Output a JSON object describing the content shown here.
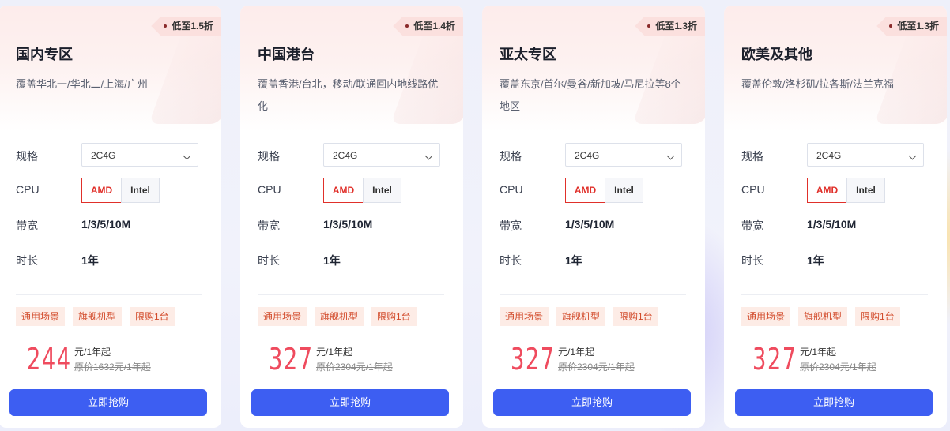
{
  "cards": [
    {
      "discount": "低至1.5折",
      "title": "国内专区",
      "description": "覆盖华北一/华北二/上海/广州",
      "spec_label": "规格",
      "spec_value": "2C4G",
      "cpu_label": "CPU",
      "cpu_options": [
        "AMD",
        "Intel"
      ],
      "cpu_selected": "AMD",
      "bandwidth_label": "带宽",
      "bandwidth_value": "1/3/5/10M",
      "duration_label": "时长",
      "duration_value": "1年",
      "tags": [
        "通用场景",
        "旗舰机型",
        "限购1台"
      ],
      "price": "244",
      "price_unit": "元/1年起",
      "original_price": "原价1632元/1年起",
      "buy_label": "立即抢购"
    },
    {
      "discount": "低至1.4折",
      "title": "中国港台",
      "description": "覆盖香港/台北，移动/联通回内地线路优化",
      "spec_label": "规格",
      "spec_value": "2C4G",
      "cpu_label": "CPU",
      "cpu_options": [
        "AMD",
        "Intel"
      ],
      "cpu_selected": "AMD",
      "bandwidth_label": "带宽",
      "bandwidth_value": "1/3/5/10M",
      "duration_label": "时长",
      "duration_value": "1年",
      "tags": [
        "通用场景",
        "旗舰机型",
        "限购1台"
      ],
      "price": "327",
      "price_unit": "元/1年起",
      "original_price": "原价2304元/1年起",
      "buy_label": "立即抢购"
    },
    {
      "discount": "低至1.3折",
      "title": "亚太专区",
      "description": "覆盖东京/首尔/曼谷/新加坡/马尼拉等8个地区",
      "spec_label": "规格",
      "spec_value": "2C4G",
      "cpu_label": "CPU",
      "cpu_options": [
        "AMD",
        "Intel"
      ],
      "cpu_selected": "AMD",
      "bandwidth_label": "带宽",
      "bandwidth_value": "1/3/5/10M",
      "duration_label": "时长",
      "duration_value": "1年",
      "tags": [
        "通用场景",
        "旗舰机型",
        "限购1台"
      ],
      "price": "327",
      "price_unit": "元/1年起",
      "original_price": "原价2304元/1年起",
      "buy_label": "立即抢购"
    },
    {
      "discount": "低至1.3折",
      "title": "欧美及其他",
      "description": "覆盖伦敦/洛杉矶/拉各斯/法兰克福",
      "spec_label": "规格",
      "spec_value": "2C4G",
      "cpu_label": "CPU",
      "cpu_options": [
        "AMD",
        "Intel"
      ],
      "cpu_selected": "AMD",
      "bandwidth_label": "带宽",
      "bandwidth_value": "1/3/5/10M",
      "duration_label": "时长",
      "duration_value": "1年",
      "tags": [
        "通用场景",
        "旗舰机型",
        "限购1台"
      ],
      "price": "327",
      "price_unit": "元/1年起",
      "original_price": "原价2304元/1年起",
      "buy_label": "立即抢购"
    }
  ],
  "colors": {
    "accent_blue": "#3d5ef2",
    "price_red": "#ef4b5e",
    "selected_border": "#e0302a",
    "tag_bg": "#fdece6",
    "tag_text": "#d24a2a"
  }
}
